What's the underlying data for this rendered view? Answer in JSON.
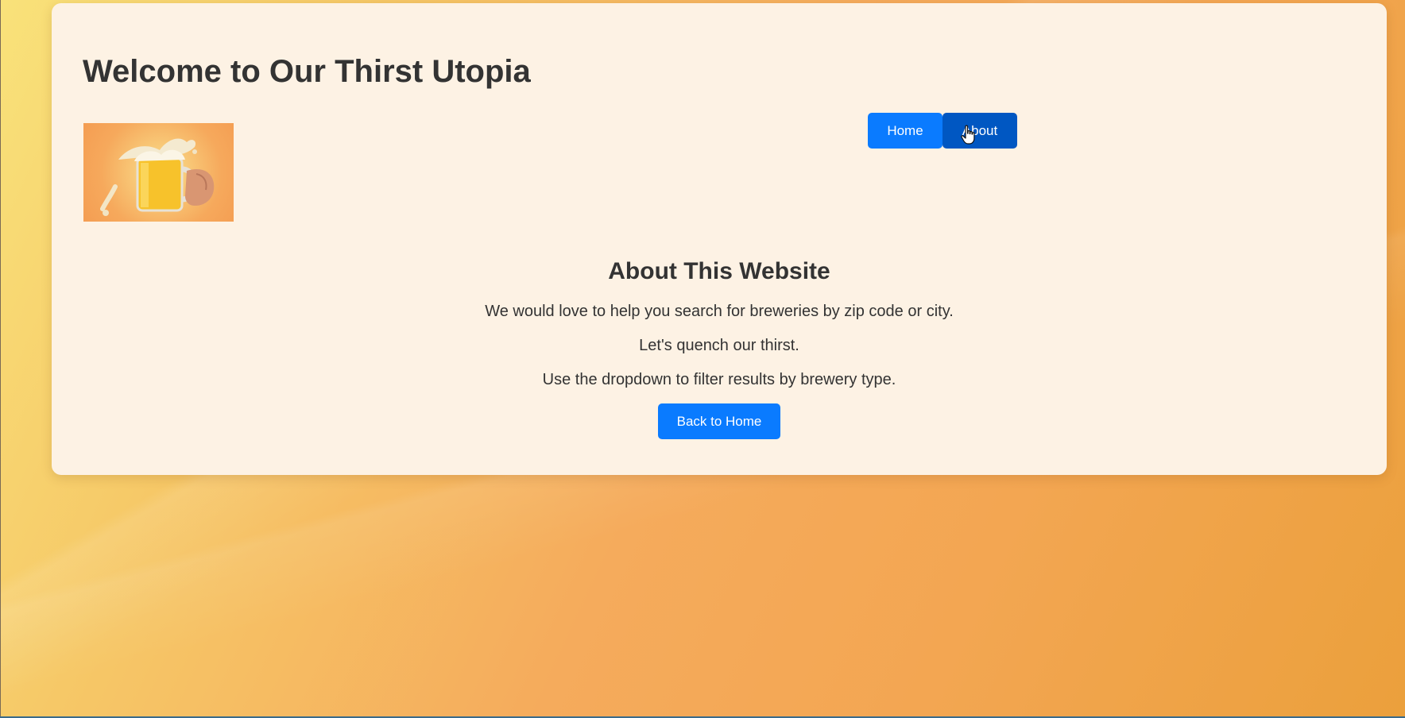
{
  "header": {
    "title": "Welcome to Our Thirst Utopia"
  },
  "hero_image": {
    "icon": "beer-mug-icon"
  },
  "nav": {
    "home_label": "Home",
    "about_label": "About"
  },
  "about": {
    "heading": "About This Website",
    "lines": [
      "We would love to help you search for breweries by zip code or city.",
      "Let's quench our thirst.",
      "Use the dropdown to filter results by brewery type."
    ],
    "back_label": "Back to Home"
  },
  "colors": {
    "primary_button": "#0a7bff",
    "active_button": "#0057c2",
    "card_background": "#fdf2e4",
    "text": "#333333"
  }
}
